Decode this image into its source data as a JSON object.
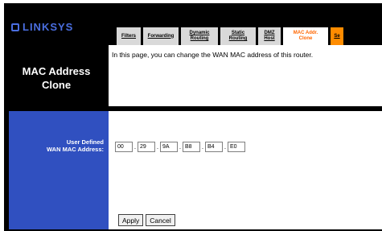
{
  "brand": {
    "logo_text": "LINKSYS"
  },
  "tabs": [
    {
      "label": "Filters",
      "active": false
    },
    {
      "label": "Forwarding",
      "active": false
    },
    {
      "label": "Dynamic Routing",
      "active": false
    },
    {
      "label": "Static Routing",
      "active": false
    },
    {
      "label": "DMZ Host",
      "active": false
    },
    {
      "label": "MAC Addr. Clone",
      "active": true
    },
    {
      "label": "Se",
      "active": false
    }
  ],
  "page": {
    "title_line1": "MAC Address",
    "title_line2": "Clone",
    "description": "In this page, you can change the WAN MAC address of this router."
  },
  "form": {
    "label_line1": "User Defined",
    "label_line2": "WAN MAC Address:",
    "mac_octets": [
      "00",
      "29",
      "9A",
      "B8",
      "B4",
      "E0"
    ]
  },
  "buttons": {
    "apply": "Apply",
    "cancel": "Cancel"
  },
  "colors": {
    "sidebar": "#3050c0",
    "active_tab_text": "#ff6600"
  }
}
